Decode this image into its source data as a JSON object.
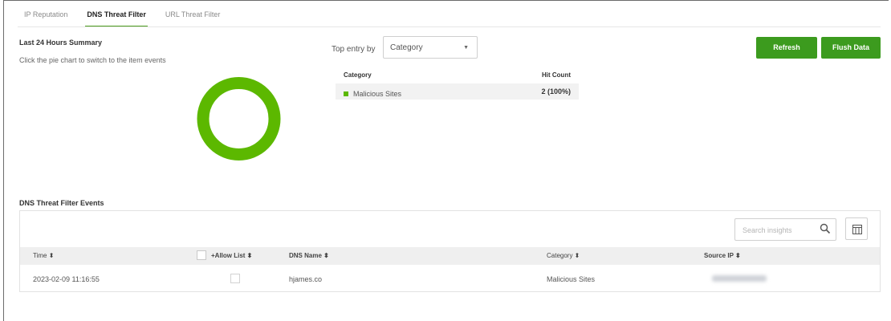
{
  "tabs": [
    {
      "label": "IP Reputation",
      "active": false
    },
    {
      "label": "DNS Threat Filter",
      "active": true
    },
    {
      "label": "URL Threat Filter",
      "active": false
    }
  ],
  "summary": {
    "title": "Last 24 Hours Summary",
    "hint": "Click the pie chart to switch to the item events"
  },
  "top_entry": {
    "label": "Top entry by",
    "selected": "Category"
  },
  "buttons": {
    "refresh": "Refresh",
    "flush": "Flush Data"
  },
  "category_table": {
    "col_category": "Category",
    "col_hit_count": "Hit Count",
    "rows": [
      {
        "name": "Malicious Sites",
        "count": "2 (100%)",
        "color": "#5cb800"
      }
    ]
  },
  "chart_data": {
    "type": "pie",
    "categories": [
      "Malicious Sites"
    ],
    "values": [
      2
    ],
    "colors": [
      "#5cb800"
    ],
    "donut": true
  },
  "events": {
    "title": "DNS Threat Filter Events",
    "search_placeholder": "Search insights",
    "columns": {
      "time": "Time ⬍",
      "allow_list": "+Allow List ⬍",
      "dns_name": "DNS Name ⬍",
      "category": "Category ⬍",
      "source_ip": "Source IP ⬍"
    },
    "rows": [
      {
        "time": "2023-02-09 11:16:55",
        "dns_name": "hjames.co",
        "category": "Malicious Sites"
      }
    ]
  },
  "colors": {
    "accent": "#3c9b1e",
    "tab_underline": "#4c9c1e"
  }
}
